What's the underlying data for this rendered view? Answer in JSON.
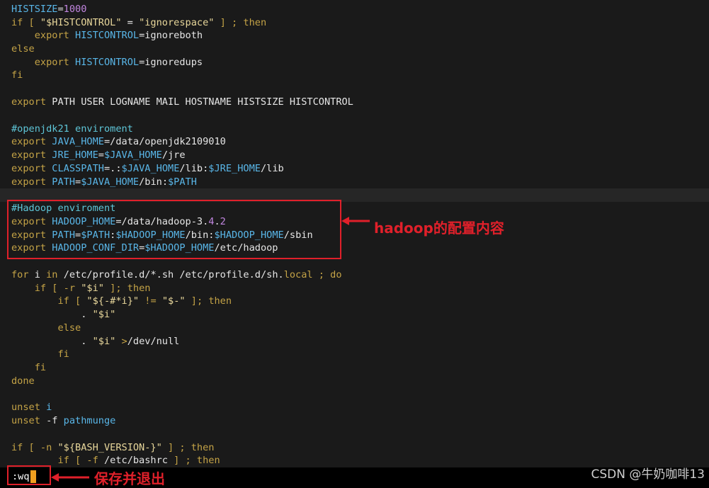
{
  "editor": {
    "lines": {
      "l1": {
        "a": "HISTSIZE",
        "b": "=",
        "c": "1000"
      },
      "l2": {
        "a": "if [ ",
        "b": "\"$HISTCONTROL\"",
        "c": " = ",
        "d": "\"ignorespace\"",
        "e": " ] ; then"
      },
      "l3": {
        "a": "    export ",
        "b": "HISTCONTROL",
        "c": "=ignoreboth"
      },
      "l4": {
        "a": "else"
      },
      "l5": {
        "a": "    export ",
        "b": "HISTCONTROL",
        "c": "=ignoredups"
      },
      "l6": {
        "a": "fi"
      },
      "l8": {
        "a": "export ",
        "b": "PATH USER LOGNAME MAIL HOSTNAME HISTSIZE HISTCONTROL"
      },
      "l10": {
        "a": "#openjdk21 enviroment"
      },
      "l11": {
        "a": "export ",
        "b": "JAVA_HOME",
        "c": "=/data/openjdk2109010"
      },
      "l12": {
        "a": "export ",
        "b": "JRE_HOME",
        "c": "=",
        "d": "$JAVA_HOME",
        "e": "/jre"
      },
      "l13": {
        "a": "export ",
        "b": "CLASSPATH",
        "c": "=.:",
        "d": "$JAVA_HOME",
        "e": "/lib:",
        "f": "$JRE_HOME",
        "g": "/lib"
      },
      "l14": {
        "a": "export ",
        "b": "PATH",
        "c": "=",
        "d": "$JAVA_HOME",
        "e": "/bin:",
        "f": "$PATH"
      },
      "l16": {
        "a": "#Hadoop enviroment"
      },
      "l17": {
        "a": "export ",
        "b": "HADOOP_HOME",
        "c": "=/data/hadoop-3.",
        "d": "4",
        "e": ".",
        "f": "2"
      },
      "l18": {
        "a": "export ",
        "b": "PATH",
        "c": "=",
        "d": "$PATH",
        "e": ":",
        "f": "$HADOOP_HOME",
        "g": "/bin:",
        "h": "$HADOOP_HOME",
        "i": "/sbin"
      },
      "l19": {
        "a": "export ",
        "b": "HADOOP_CONF_DIR",
        "c": "=",
        "d": "$HADOOP_HOME",
        "e": "/etc/hadoop"
      },
      "l21": {
        "a": "for ",
        "b": "i",
        "c": " in ",
        "d": "/etc/profile.d/*.sh /etc/profile.d/sh.",
        "e": "local",
        "f": " ; do"
      },
      "l22": {
        "a": "    if [ -r ",
        "b": "\"$i\"",
        "c": " ]; then"
      },
      "l23": {
        "a": "        if [ ",
        "b": "\"${-#*i}\"",
        "c": " != ",
        "d": "\"$-\"",
        "e": " ]; then"
      },
      "l24": {
        "a": "            . ",
        "b": "\"$i\""
      },
      "l25": {
        "a": "        else"
      },
      "l26": {
        "a": "            . ",
        "b": "\"$i\"",
        "c": " >",
        "d": "/dev/null"
      },
      "l27": {
        "a": "        fi"
      },
      "l28": {
        "a": "    fi"
      },
      "l29": {
        "a": "done"
      },
      "l31": {
        "a": "unset ",
        "b": "i"
      },
      "l32": {
        "a": "unset ",
        "b": "-f ",
        "c": "pathmunge"
      },
      "l34": {
        "a": "if [ -n ",
        "b": "\"${BASH_VERSION-}\"",
        "c": " ] ; then"
      },
      "l35": {
        "a": "        if [ -f ",
        "b": "/etc/bashrc",
        "c": " ] ; then"
      }
    }
  },
  "command_line": {
    "text": ":wq"
  },
  "annotations": {
    "hadoop_label": "hadoop的配置内容",
    "save_label": "保存并退出"
  },
  "watermark": "CSDN @牛奶咖啡13",
  "colors": {
    "annotation": "#e0202a",
    "cursor": "#f0a020",
    "background": "#1a1a1a"
  }
}
